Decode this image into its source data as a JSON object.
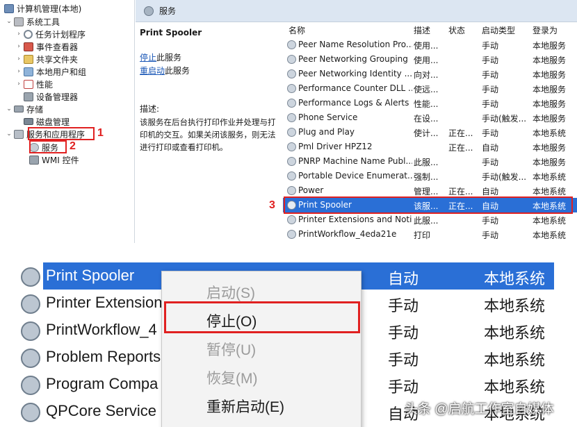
{
  "tree": {
    "items": [
      {
        "label": "计算机管理(本地)",
        "icon": "computer-icon",
        "twisty": ""
      },
      {
        "label": "系统工具",
        "icon": "tools-icon",
        "twisty": "⌄"
      },
      {
        "label": "任务计划程序",
        "icon": "clock-icon",
        "twisty": "›"
      },
      {
        "label": "事件查看器",
        "icon": "event-viewer-icon",
        "twisty": "›"
      },
      {
        "label": "共享文件夹",
        "icon": "shared-folder-icon",
        "twisty": "›"
      },
      {
        "label": "本地用户和组",
        "icon": "users-icon",
        "twisty": "›"
      },
      {
        "label": "性能",
        "icon": "performance-icon",
        "twisty": "›"
      },
      {
        "label": "设备管理器",
        "icon": "device-manager-icon",
        "twisty": ""
      },
      {
        "label": "存储",
        "icon": "storage-icon",
        "twisty": "⌄"
      },
      {
        "label": "磁盘管理",
        "icon": "disk-icon",
        "twisty": ""
      },
      {
        "label": "服务和应用程序",
        "icon": "services-apps-icon",
        "twisty": "⌄"
      },
      {
        "label": "服务",
        "icon": "gear-icon",
        "twisty": ""
      },
      {
        "label": "WMI 控件",
        "icon": "wmi-icon",
        "twisty": ""
      }
    ]
  },
  "annotations": {
    "step1": "1",
    "step2": "2",
    "step3": "3"
  },
  "services_header": {
    "title": "服务"
  },
  "detail": {
    "service_name": "Print Spooler",
    "stop_link": "停止",
    "stop_suffix": "此服务",
    "restart_link": "重启动",
    "restart_suffix": "此服务",
    "desc_label": "描述:",
    "desc_text": "该服务在后台执行打印作业并处理与打印机的交互。如果关闭该服务，则无法进行打印或查看打印机。"
  },
  "columns": {
    "name": "名称",
    "desc": "描述",
    "status": "状态",
    "startup": "启动类型",
    "logon": "登录为"
  },
  "services": [
    {
      "name": "Peer Name Resolution Pro...",
      "desc": "使用...",
      "status": "",
      "startup": "手动",
      "logon": "本地服务"
    },
    {
      "name": "Peer Networking Grouping",
      "desc": "使用...",
      "status": "",
      "startup": "手动",
      "logon": "本地服务"
    },
    {
      "name": "Peer Networking Identity ...",
      "desc": "向对...",
      "status": "",
      "startup": "手动",
      "logon": "本地服务"
    },
    {
      "name": "Performance Counter DLL ...",
      "desc": "使远...",
      "status": "",
      "startup": "手动",
      "logon": "本地服务"
    },
    {
      "name": "Performance Logs & Alerts",
      "desc": "性能...",
      "status": "",
      "startup": "手动",
      "logon": "本地服务"
    },
    {
      "name": "Phone Service",
      "desc": "在设...",
      "status": "",
      "startup": "手动(触发...",
      "logon": "本地服务"
    },
    {
      "name": "Plug and Play",
      "desc": "使计...",
      "status": "正在...",
      "startup": "手动",
      "logon": "本地系统"
    },
    {
      "name": "Pml Driver HPZ12",
      "desc": "",
      "status": "正在...",
      "startup": "自动",
      "logon": "本地服务"
    },
    {
      "name": "PNRP Machine Name Publ...",
      "desc": "此服...",
      "status": "",
      "startup": "手动",
      "logon": "本地服务"
    },
    {
      "name": "Portable Device Enumerat...",
      "desc": "强制...",
      "status": "",
      "startup": "手动(触发...",
      "logon": "本地系统"
    },
    {
      "name": "Power",
      "desc": "管理...",
      "status": "正在...",
      "startup": "自动",
      "logon": "本地系统"
    },
    {
      "name": "Print Spooler",
      "desc": "该服...",
      "status": "正在...",
      "startup": "自动",
      "logon": "本地系统"
    },
    {
      "name": "Printer Extensions and Noti...",
      "desc": "此服...",
      "status": "",
      "startup": "手动",
      "logon": "本地系统"
    },
    {
      "name": "PrintWorkflow_4eda21e",
      "desc": "打印",
      "status": "",
      "startup": "手动",
      "logon": "本地系统"
    }
  ],
  "zoom": {
    "rows": [
      {
        "name": "Print Spooler",
        "desc": "该服...",
        "status": "正在...",
        "startup": "自动",
        "logon": "本地系统"
      },
      {
        "name": "Printer Extensions",
        "startup": "手动",
        "logon": "本地系统"
      },
      {
        "name": "PrintWorkflow_4",
        "startup": "手动",
        "logon": "本地系统"
      },
      {
        "name": "Problem Reports",
        "startup": "手动",
        "logon": "本地系统"
      },
      {
        "name": "Program Compa",
        "startup": "手动",
        "logon": "本地系统"
      },
      {
        "name": "QPCore Service",
        "startup": "自动",
        "logon": "本地系统"
      }
    ],
    "menu": [
      {
        "label": "启动(S)",
        "enabled": false
      },
      {
        "label": "停止(O)",
        "enabled": true
      },
      {
        "label": "暂停(U)",
        "enabled": false
      },
      {
        "label": "恢复(M)",
        "enabled": false
      },
      {
        "label": "重新启动(E)",
        "enabled": true
      }
    ]
  },
  "watermark": "头条 @启航工作室自媒体",
  "colors": {
    "selection": "#2a6fd6",
    "annotation": "#e02020",
    "header_bg": "#dce6f2"
  }
}
